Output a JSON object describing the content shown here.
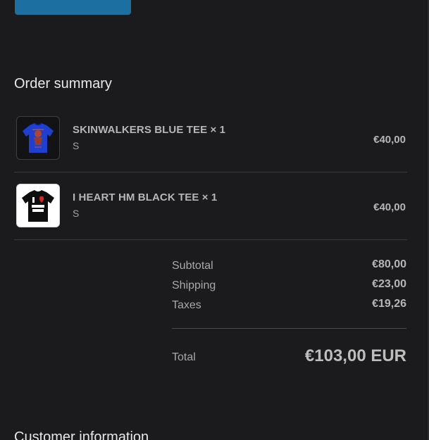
{
  "order_summary": {
    "title": "Order summary",
    "items": [
      {
        "name": "SKINWALKERS BLUE TEE × 1",
        "variant": "S",
        "price": "€40,00",
        "thumbnail_icon": "blue-tshirt-icon"
      },
      {
        "name": "I HEART HM BLACK TEE × 1",
        "variant": "S",
        "price": "€40,00",
        "thumbnail_icon": "black-tshirt-icon"
      }
    ],
    "subtotal_label": "Subtotal",
    "subtotal_value": "€80,00",
    "shipping_label": "Shipping",
    "shipping_value": "€23,00",
    "taxes_label": "Taxes",
    "taxes_value": "€19,26",
    "total_label": "Total",
    "total_value": "€103,00 EUR"
  },
  "customer_information": {
    "title": "Customer information"
  },
  "colors": {
    "background": "#1b1b1d",
    "accent_button": "#1c6fa1",
    "tee_blue": "#1f3fd1",
    "tee_black": "#0e0e0e"
  }
}
